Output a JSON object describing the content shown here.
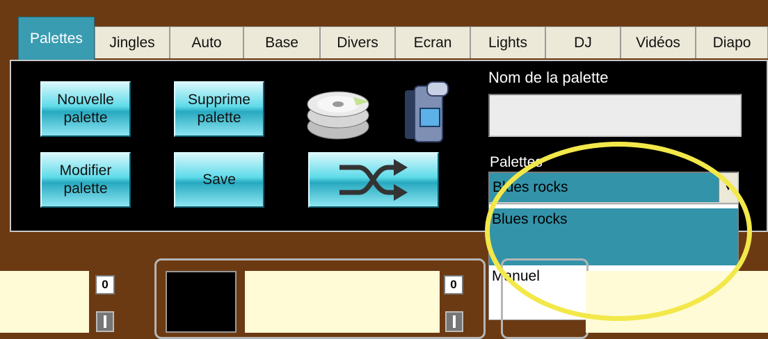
{
  "tabs": [
    "Palettes",
    "Jingles",
    "Auto",
    "Base",
    "Divers",
    "Ecran",
    "Lights",
    "DJ",
    "Vidéos",
    "Diapo"
  ],
  "active_tab": "Palettes",
  "buttons": {
    "new_line1": "Nouvelle",
    "new_line2": "palette",
    "delete_line1": "Supprime",
    "delete_line2": "palette",
    "modify_line1": "Modifier",
    "modify_line2": "palette",
    "save": "Save"
  },
  "icons": {
    "cd_stack": "cd-stack-icon",
    "camera": "video-camera-icon",
    "shuffle": "shuffle-icon"
  },
  "name_field": {
    "label": "Nom de la palette",
    "value": ""
  },
  "palettes": {
    "label": "Palettes",
    "selected": "Blues rocks",
    "options": [
      "Blues rocks",
      "Manuel"
    ]
  },
  "mixer": {
    "levels": [
      "0",
      "0"
    ]
  },
  "colors": {
    "accent": "#3393a9",
    "button": "#5fdbe9",
    "highlight": "#f2e84a",
    "frame": "#6b3a12"
  }
}
